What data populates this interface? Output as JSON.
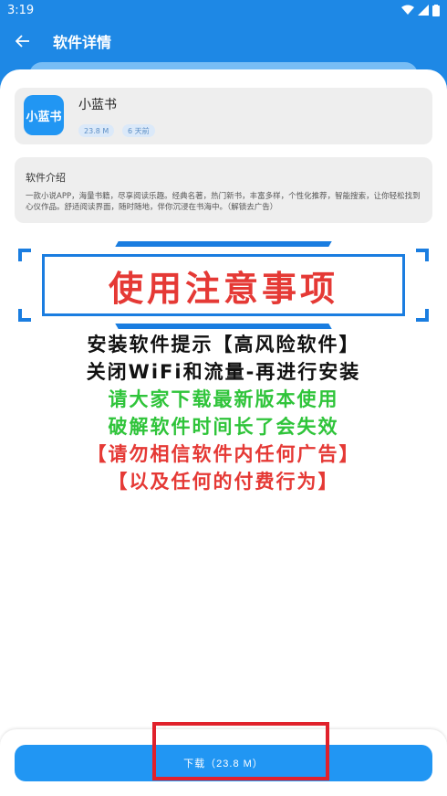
{
  "status": {
    "time": "3:19"
  },
  "header": {
    "title": "软件详情"
  },
  "app": {
    "name": "小蓝书",
    "icon_text": "小蓝书",
    "size": "23.8 M",
    "date": "6 天前"
  },
  "intro": {
    "title": "软件介绍",
    "text": "一款小说APP，海量书籍，尽享阅读乐趣。经典名著，热门新书，丰富多样，个性化推荐，智能搜索，让你轻松找到心仪作品。舒适阅读界面，随时随地，伴你沉浸在书海中。（解锁去广告）"
  },
  "notice": {
    "banner": "使用注意事项",
    "lines": [
      "安装软件提示【高风险软件】",
      "关闭WiFi和流量-再进行安装",
      "请大家下载最新版本使用",
      "破解软件时间长了会失效",
      "【请勿相信软件内任何广告】",
      "【以及任何的付费行为】"
    ]
  },
  "download": {
    "label": "下载（23.8 M）"
  },
  "colors": {
    "primary": "#2196f3",
    "alert": "#e53935",
    "success": "#2fc43a"
  }
}
